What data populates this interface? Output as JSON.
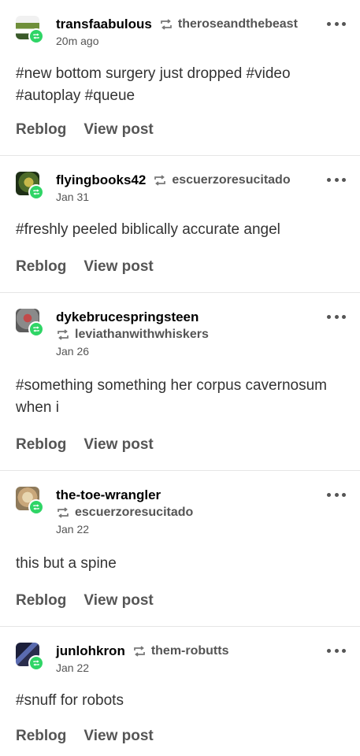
{
  "posts": [
    {
      "blog": "transfaabulous",
      "source": "theroseandthebeast",
      "time": "20m ago",
      "body": "#new bottom surgery just dropped  #video  #autoplay   #queue",
      "reblog": "Reblog",
      "view": "View post"
    },
    {
      "blog": "flyingbooks42",
      "source": "escuerzoresucitado",
      "time": "Jan 31",
      "body": "#freshly peeled biblically accurate angel",
      "reblog": "Reblog",
      "view": "View post"
    },
    {
      "blog": "dykebrucespringsteen",
      "source": "leviathanwithwhiskers",
      "time": "Jan 26",
      "body": "#something something her corpus cavernosum when i",
      "reblog": "Reblog",
      "view": "View post"
    },
    {
      "blog": "the-toe-wrangler",
      "source": "escuerzoresucitado",
      "time": "Jan 22",
      "body": "this but a spine",
      "reblog": "Reblog",
      "view": "View post"
    },
    {
      "blog": "junlohkron",
      "source": "them-robutts",
      "time": "Jan 22",
      "body": "#snuff for robots",
      "reblog": "Reblog",
      "view": "View post"
    }
  ],
  "colors": {
    "badge": "#2fd566",
    "meta": "#555555"
  },
  "icons": {
    "reblog": "reblog-icon",
    "more": "more-options-icon",
    "badge": "reblog-badge-icon"
  }
}
